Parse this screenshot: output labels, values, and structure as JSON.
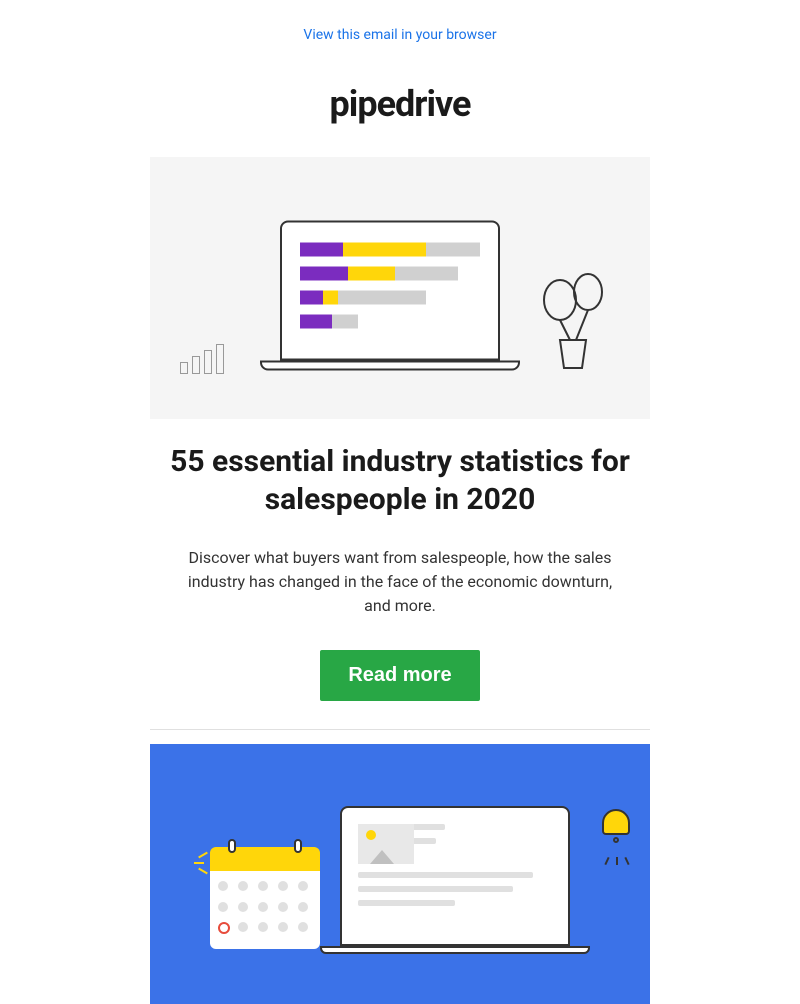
{
  "header": {
    "view_in_browser": "View this email in your browser",
    "logo_text": "pipedrive"
  },
  "article1": {
    "headline": "55 essential industry statistics for salespeople in 2020",
    "body": "Discover what buyers want from salespeople, how the sales industry has changed in the face of the economic downturn, and more.",
    "cta_label": "Read more"
  },
  "colors": {
    "cta_bg": "#28a745",
    "link": "#1a73e8",
    "hero2_bg": "#3b72e8",
    "accent_yellow": "#ffd60a",
    "accent_purple": "#7b2cbf"
  }
}
